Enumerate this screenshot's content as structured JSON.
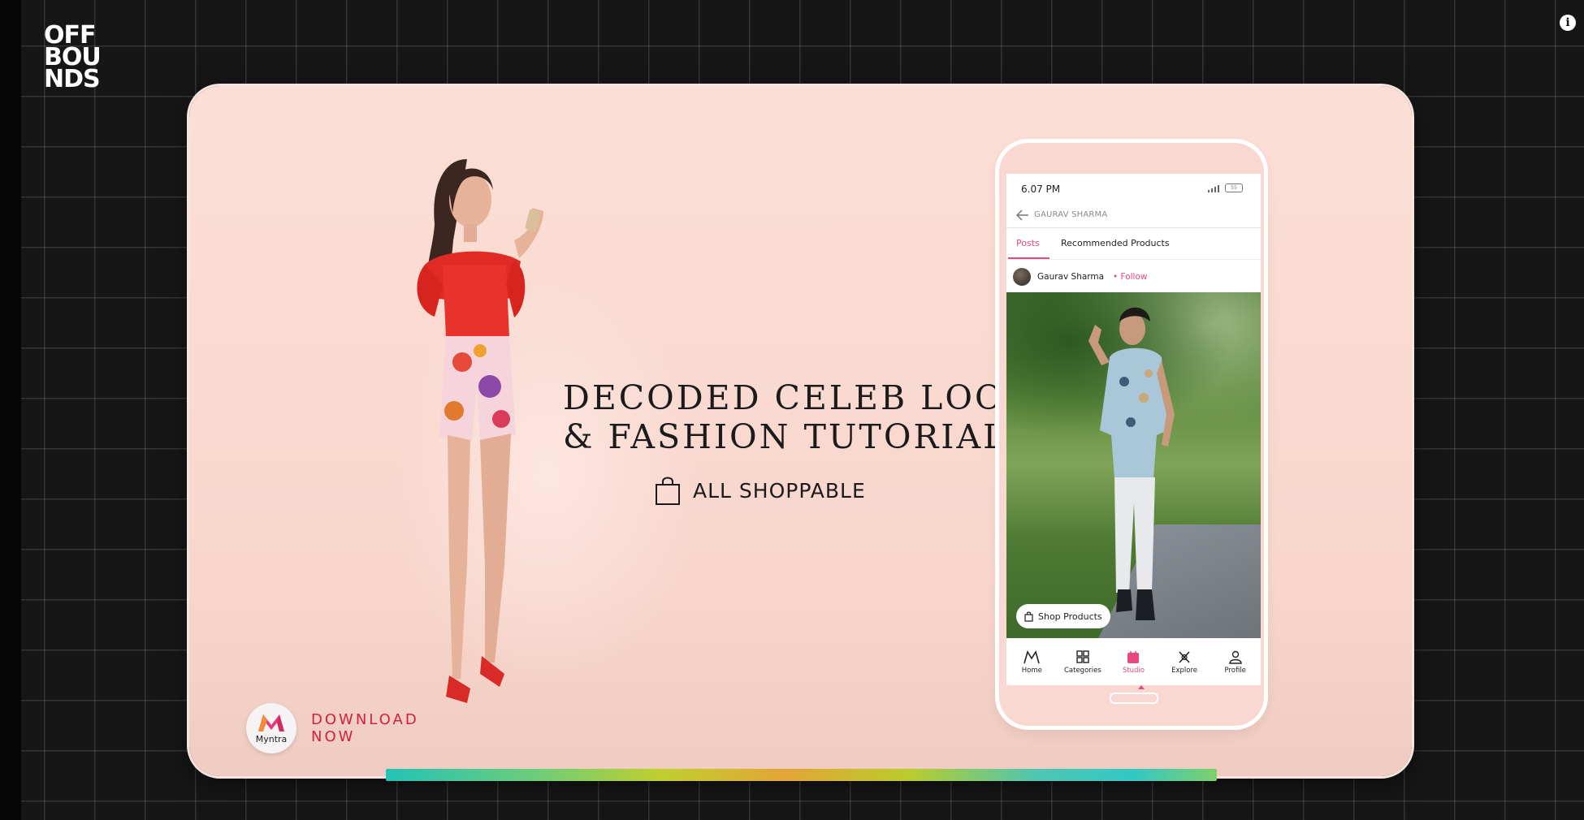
{
  "brand": {
    "logo_lines": [
      "OFF",
      "BOU",
      "NDS"
    ]
  },
  "info_icon": "i",
  "ad": {
    "headline_lines": [
      "DECODED CELEB LOOKS",
      "& FASHION TUTORIALS"
    ],
    "shoppable_label": "ALL SHOPPABLE",
    "app_name": "Myntra",
    "cta_lines": [
      "DOWNLOAD",
      "NOW"
    ],
    "accent_color": "#d2213d"
  },
  "phone": {
    "status_time": "6.07 PM",
    "battery_label": "55",
    "nav_title": "GAURAV SHARMA",
    "tabs": [
      {
        "label": "Posts",
        "active": true
      },
      {
        "label": "Recommended Products",
        "active": false
      }
    ],
    "author_name": "Gaurav Sharma",
    "follow_label": "• Follow",
    "shop_products_label": "Shop Products",
    "bottom_nav": [
      {
        "label": "Home",
        "icon": "myntra-m-icon",
        "active": false
      },
      {
        "label": "Categories",
        "icon": "grid-icon",
        "active": false
      },
      {
        "label": "Studio",
        "icon": "studio-icon",
        "active": true
      },
      {
        "label": "Explore",
        "icon": "explore-icon",
        "active": false
      },
      {
        "label": "Profile",
        "icon": "profile-icon",
        "active": false
      }
    ],
    "accent_color": "#e6497e"
  },
  "video": {
    "progress_fraction": 1.0
  }
}
